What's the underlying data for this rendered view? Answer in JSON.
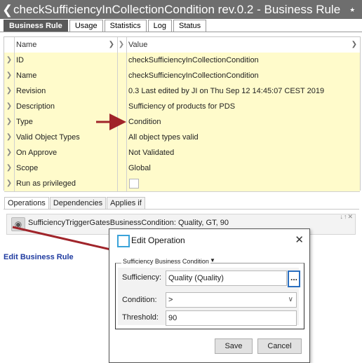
{
  "window": {
    "title": "checkSufficiencyInCollectionCondition rev.0.2 - Business Rule"
  },
  "tabs": [
    "Business Rule",
    "Usage",
    "Statistics",
    "Log",
    "Status"
  ],
  "table": {
    "headers": {
      "name": "Name",
      "value": "Value"
    },
    "rows": [
      {
        "name": "ID",
        "value": "checkSufficiencyInCollectionCondition"
      },
      {
        "name": "Name",
        "value": "checkSufficiencyInCollectionCondition"
      },
      {
        "name": "Revision",
        "value": "0.3 Last edited by JI on Thu Sep 12 14:45:07 CEST 2019"
      },
      {
        "name": "Description",
        "value": "Sufficiency of products for PDS"
      },
      {
        "name": "Type",
        "value": "Condition"
      },
      {
        "name": "Valid Object Types",
        "value": "All object types valid"
      },
      {
        "name": "On Approve",
        "value": "Not Validated"
      },
      {
        "name": "Scope",
        "value": "Global"
      },
      {
        "name": "Run as privileged",
        "value": ""
      }
    ]
  },
  "bottom_tabs": [
    "Operations",
    "Dependencies",
    "Applies if"
  ],
  "operation": {
    "text": "SufficiencyTriggerGatesBusinessCondition: Quality, GT, 90"
  },
  "edit_link": "Edit Business Rule",
  "dialog": {
    "title": "Edit Operation",
    "group_label": "Sufficiency Business Condition",
    "fields": {
      "sufficiency_label": "Sufficiency:",
      "sufficiency_value": "Quality (Quality)",
      "browse_label": "...",
      "condition_label": "Condition:",
      "condition_value": ">",
      "threshold_label": "Threshold:",
      "threshold_value": "90"
    },
    "buttons": {
      "save": "Save",
      "cancel": "Cancel"
    }
  },
  "colors": {
    "title_bar": "#6e6e6e",
    "row_highlight": "#fffbcb",
    "annotation_arrow": "#a0242a",
    "link": "#1f3ba0"
  }
}
